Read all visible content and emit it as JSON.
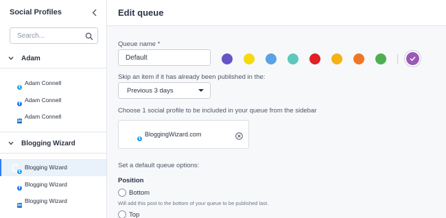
{
  "sidebar": {
    "title": "Social Profiles",
    "search_placeholder": "Search...",
    "groups": [
      {
        "name": "Adam",
        "profiles": [
          {
            "name": "Adam Connell",
            "network": "twitter",
            "active": false
          },
          {
            "name": "Adam Connell",
            "network": "facebook",
            "active": false
          },
          {
            "name": "Adam Connell",
            "network": "linkedin",
            "active": false
          }
        ]
      },
      {
        "name": "Blogging Wizard",
        "profiles": [
          {
            "name": "Blogging Wizard",
            "network": "twitter",
            "active": true
          },
          {
            "name": "Blogging Wizard",
            "network": "facebook",
            "active": false
          },
          {
            "name": "Blogging Wizard",
            "network": "linkedin",
            "active": false
          }
        ]
      }
    ]
  },
  "main": {
    "title": "Edit queue",
    "queue_name_label": "Queue name *",
    "queue_name_value": "Default",
    "colors": [
      "#6655c4",
      "#f5d90e",
      "#5aa2e3",
      "#5fc8bd",
      "#e01f26",
      "#f4b213",
      "#f07623",
      "#4caf50",
      "#9b59b6"
    ],
    "selected_color": "#9b59b6",
    "skip_label": "Skip an item if it has already been published in the:",
    "skip_value": "Previous 3 days",
    "choose_label": "Choose 1 social profile to be included in your queue from the sidebar",
    "selected_profile": {
      "name": "BloggingWizard.com",
      "network": "twitter"
    },
    "default_options_label": "Set a default queue options:",
    "position_label": "Position",
    "position_options": [
      {
        "label": "Bottom",
        "hint": "Will add this post to the bottom of your queue to be published last."
      },
      {
        "label": "Top",
        "hint": ""
      }
    ]
  }
}
